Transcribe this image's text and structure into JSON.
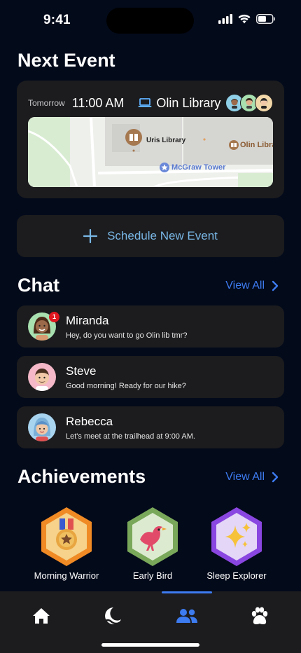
{
  "status": {
    "time": "9:41"
  },
  "next_event": {
    "title": "Next Event",
    "day": "Tomorrow",
    "time": "11:00 AM",
    "place": "Olin Library",
    "map": {
      "labels": {
        "uris": "Uris Library",
        "olin": "Olin Libra",
        "mcgraw": "McGraw Tower"
      }
    }
  },
  "schedule": {
    "label": "Schedule New Event"
  },
  "chat": {
    "title": "Chat",
    "view_all": "View All",
    "items": [
      {
        "name": "Miranda",
        "message": "Hey, do you want to go Olin lib tmr?",
        "badge": "1"
      },
      {
        "name": "Steve",
        "message": "Good morning! Ready for our hike?"
      },
      {
        "name": "Rebecca",
        "message": "Let's meet at the trailhead at 9:00 AM."
      }
    ]
  },
  "achievements": {
    "title": "Achievements",
    "view_all": "View All",
    "items": [
      {
        "label": "Morning Warrior",
        "icon": "medal-icon",
        "color": "#f08a24"
      },
      {
        "label": "Early Bird",
        "icon": "bird-icon",
        "color": "#7aa85a"
      },
      {
        "label": "Sleep Explorer",
        "icon": "sparkles-icon",
        "color": "#8a46e0"
      }
    ]
  },
  "tabs": [
    {
      "icon": "home-icon"
    },
    {
      "icon": "moon-icon"
    },
    {
      "icon": "people-icon",
      "active": true
    },
    {
      "icon": "paw-icon"
    }
  ],
  "colors": {
    "accent": "#3d7bf0",
    "background": "#030a1a",
    "card": "#1c1c1e",
    "schedule_text": "#79b7e6",
    "badge": "#e0171f"
  }
}
